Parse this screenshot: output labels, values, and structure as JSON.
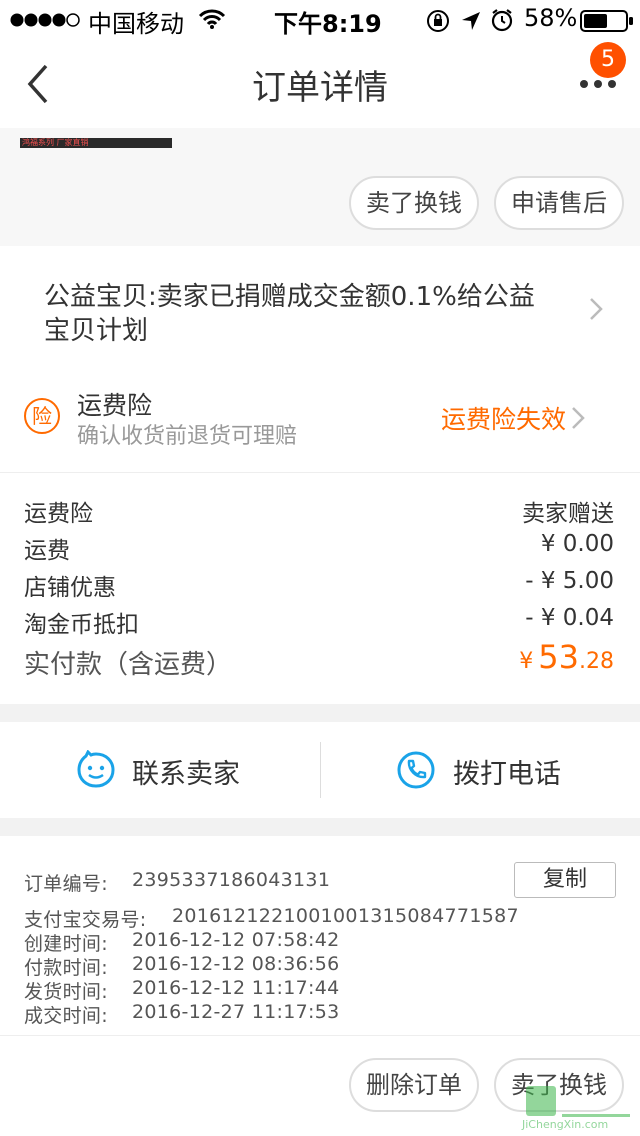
{
  "status_bar": {
    "carrier": "中国移动",
    "time": "下午8:19",
    "battery": "58%",
    "battery_level": 0.58
  },
  "nav": {
    "title": "订单详情",
    "badge_count": "5"
  },
  "top_banner": {
    "text": "鸿福系列  厂家直销"
  },
  "top_actions": {
    "sell_label": "卖了换钱",
    "after_sale_label": "申请售后"
  },
  "charity": {
    "text_line1": "公益宝贝:卖家已捐赠成交金额0.1%给公益",
    "text_line2": "宝贝计划"
  },
  "insurance": {
    "icon_char": "险",
    "title": "运费险",
    "subtitle": "确认收货前退货可理赔",
    "status": "运费险失效"
  },
  "fees": [
    {
      "label": "运费险",
      "value": "卖家赠送"
    },
    {
      "label": "运费",
      "value": "¥ 0.00"
    },
    {
      "label": "店铺优惠",
      "value": "- ¥ 5.00"
    },
    {
      "label": "淘金币抵扣",
      "value": "- ¥ 0.04"
    }
  ],
  "total": {
    "label": "实付款（含运费）",
    "currency": "¥",
    "integer": "53",
    "decimal": ".28"
  },
  "contact": {
    "seller_label": "联系卖家",
    "phone_label": "拨打电话"
  },
  "order_info": {
    "order_no_label": "订单编号:",
    "order_no": "2395337186043131",
    "copy_label": "复制",
    "alipay_label": "支付宝交易号:",
    "alipay_no": "2016121221001001315084771587",
    "created_label": "创建时间:",
    "created": "2016-12-12 07:58:42",
    "paid_label": "付款时间:",
    "paid": "2016-12-12 08:36:56",
    "shipped_label": "发货时间:",
    "shipped": "2016-12-12 11:17:44",
    "closed_label": "成交时间:",
    "closed": "2016-12-27 11:17:53"
  },
  "bottom_actions": {
    "delete_label": "删除订单",
    "sell_label": "卖了换钱"
  },
  "watermark": {
    "text": "JiChengXin.com"
  },
  "colors": {
    "accent": "#ff5000",
    "orange_text": "#ff6a00",
    "blue_icon": "#1aa3e8"
  }
}
